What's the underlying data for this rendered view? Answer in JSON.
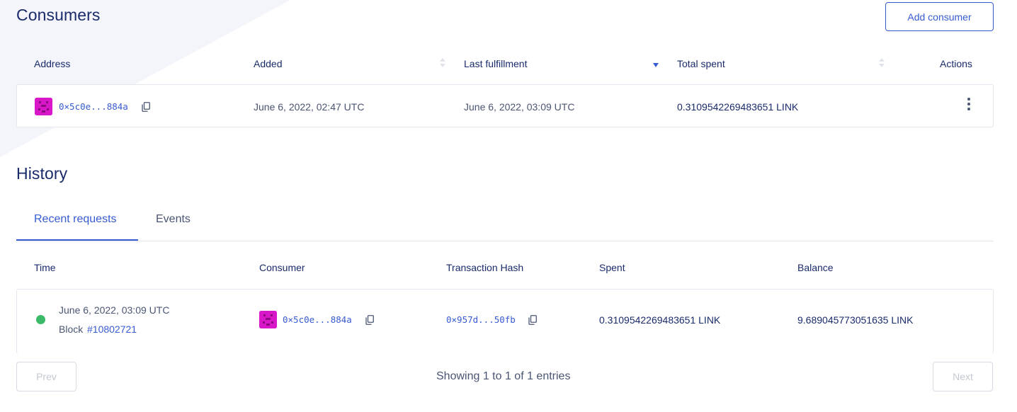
{
  "consumers": {
    "title": "Consumers",
    "add_button_label": "Add consumer",
    "columns": [
      "Address",
      "Added",
      "Last fulfillment",
      "Total spent",
      "Actions"
    ],
    "rows": [
      {
        "address": "0×5c0e...884a",
        "added": "June 6, 2022, 02:47 UTC",
        "last_fulfillment": "June 6, 2022, 03:09 UTC",
        "total_spent": "0.3109542269483651 LINK"
      }
    ]
  },
  "history": {
    "title": "History",
    "tabs": [
      {
        "label": "Recent requests",
        "active": true
      },
      {
        "label": "Events",
        "active": false
      }
    ],
    "columns": [
      "Time",
      "Consumer",
      "Transaction Hash",
      "Spent",
      "Balance"
    ],
    "rows": [
      {
        "time": "June 6, 2022, 03:09 UTC",
        "block_label": "Block",
        "block_number": "#10802721",
        "consumer": "0×5c0e...884a",
        "tx_hash": "0×957d...50fb",
        "spent": "0.3109542269483651 LINK",
        "balance": "9.689045773051635 LINK",
        "status_color": "#3bba6a"
      }
    ]
  },
  "pagination": {
    "prev_label": "Prev",
    "next_label": "Next",
    "info": "Showing 1 to 1 of 1 entries"
  },
  "colors": {
    "accent": "#375bd2",
    "heading": "#1a2b6b",
    "avatar": "#d818c8",
    "success": "#3bba6a"
  }
}
